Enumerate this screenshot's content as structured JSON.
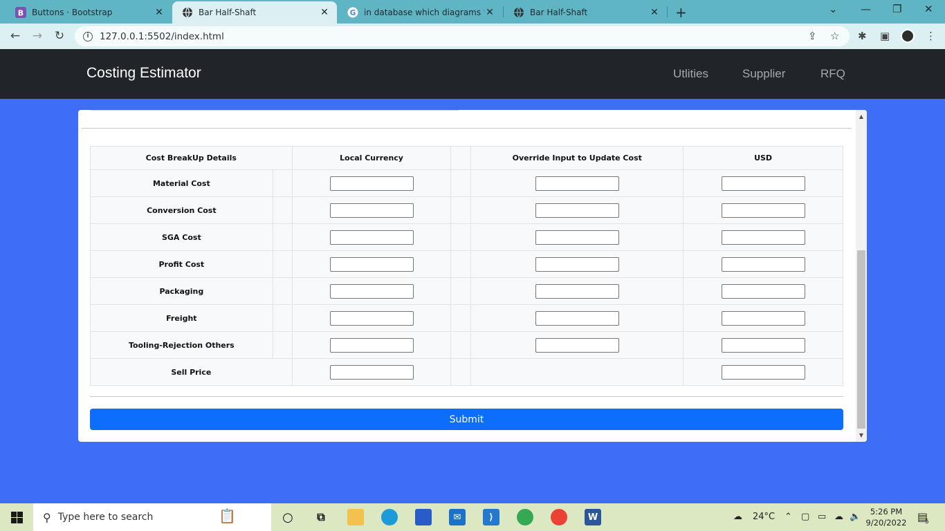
{
  "browser": {
    "tabs": [
      {
        "title": "Buttons · Bootstrap",
        "icon": "bootstrap-icon"
      },
      {
        "title": "Bar Half-Shaft",
        "icon": "globe-icon"
      },
      {
        "title": "in database which diagrams we v",
        "icon": "google-icon"
      },
      {
        "title": "Bar Half-Shaft",
        "icon": "globe-icon"
      }
    ],
    "url": "127.0.0.1:5502/index.html"
  },
  "navbar": {
    "brand": "Costing Estimator",
    "links": [
      "Utlities",
      "Supplier",
      "RFQ"
    ]
  },
  "table": {
    "headers": [
      "Cost BreakUp Details",
      "Local Currency",
      "Override Input to Update Cost",
      "USD"
    ],
    "rows": [
      "Material Cost",
      "Conversion Cost",
      "SGA Cost",
      "Profit Cost",
      "Packaging",
      "Freight",
      "Tooling-Rejection Others"
    ],
    "total_row": "Sell Price"
  },
  "submit_label": "Submit",
  "taskbar": {
    "search_placeholder": "Type here to search",
    "weather": "24°C",
    "time": "5:26 PM",
    "date": "9/20/2022",
    "notification_count": "5"
  }
}
